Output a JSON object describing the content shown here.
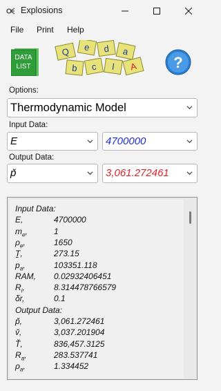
{
  "window": {
    "title": "Explosions"
  },
  "menu": [
    "File",
    "Print",
    "Help"
  ],
  "toolbar": {
    "data_list_label": [
      "DATA",
      "LIST"
    ],
    "help_glyph": "?"
  },
  "options": {
    "label": "Options:",
    "selected": "Thermodynamic Model"
  },
  "input": {
    "label": "Input Data:",
    "variable": "E",
    "value": "4700000"
  },
  "output": {
    "label": "Output Data:",
    "variable": "p̌",
    "value": "3,061.272461"
  },
  "colors": {
    "input_value": "#1f2bd6",
    "output_value": "#e0242a",
    "help_bg": "#2a7fd4",
    "data_list_bg": "#2e9d3a"
  },
  "results": [
    {
      "k": "Input Data:",
      "v": ""
    },
    {
      "k": "E,",
      "v": "4700000"
    },
    {
      "k": "m",
      "sub": "e",
      "v": "1"
    },
    {
      "k": "ρ",
      "sub": "e",
      "v": "1650"
    },
    {
      "k": "Ṯ,",
      "v": "273.15"
    },
    {
      "k": "p",
      "sub": "a",
      "v": "103351.118"
    },
    {
      "k": "RAM,",
      "v": "0.02932406451"
    },
    {
      "k": "R",
      "sub": "i",
      "v": "8.314478766579"
    },
    {
      "k": "δr,",
      "v": "0.1"
    },
    {
      "k": "Output Data:",
      "v": ""
    },
    {
      "k": "p̌,",
      "v": "3,061.272461"
    },
    {
      "k": "v̌,",
      "v": "3,037.201904"
    },
    {
      "k": "Ť,",
      "v": "836,457.3125"
    },
    {
      "k": "R",
      "sub": "a",
      "v": "283.537741"
    },
    {
      "k": "ρ",
      "sub": "a",
      "v": "1.334452"
    }
  ]
}
